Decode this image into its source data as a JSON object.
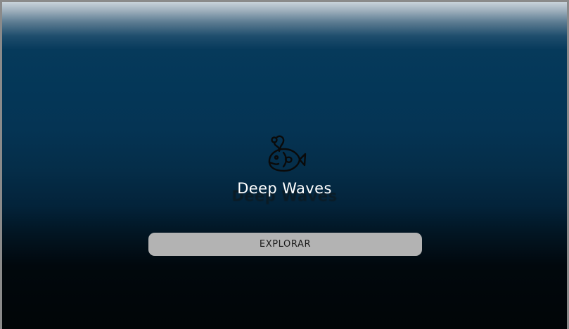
{
  "app": {
    "title": "Deep Waves",
    "logo_icon": "anglerfish-icon"
  },
  "actions": {
    "explore_label": "EXPLORAR"
  },
  "colors": {
    "background_top": "#063a5b",
    "background_bottom": "#010507",
    "button_background": "#b3b3b3",
    "title_text": "#ffffff"
  }
}
